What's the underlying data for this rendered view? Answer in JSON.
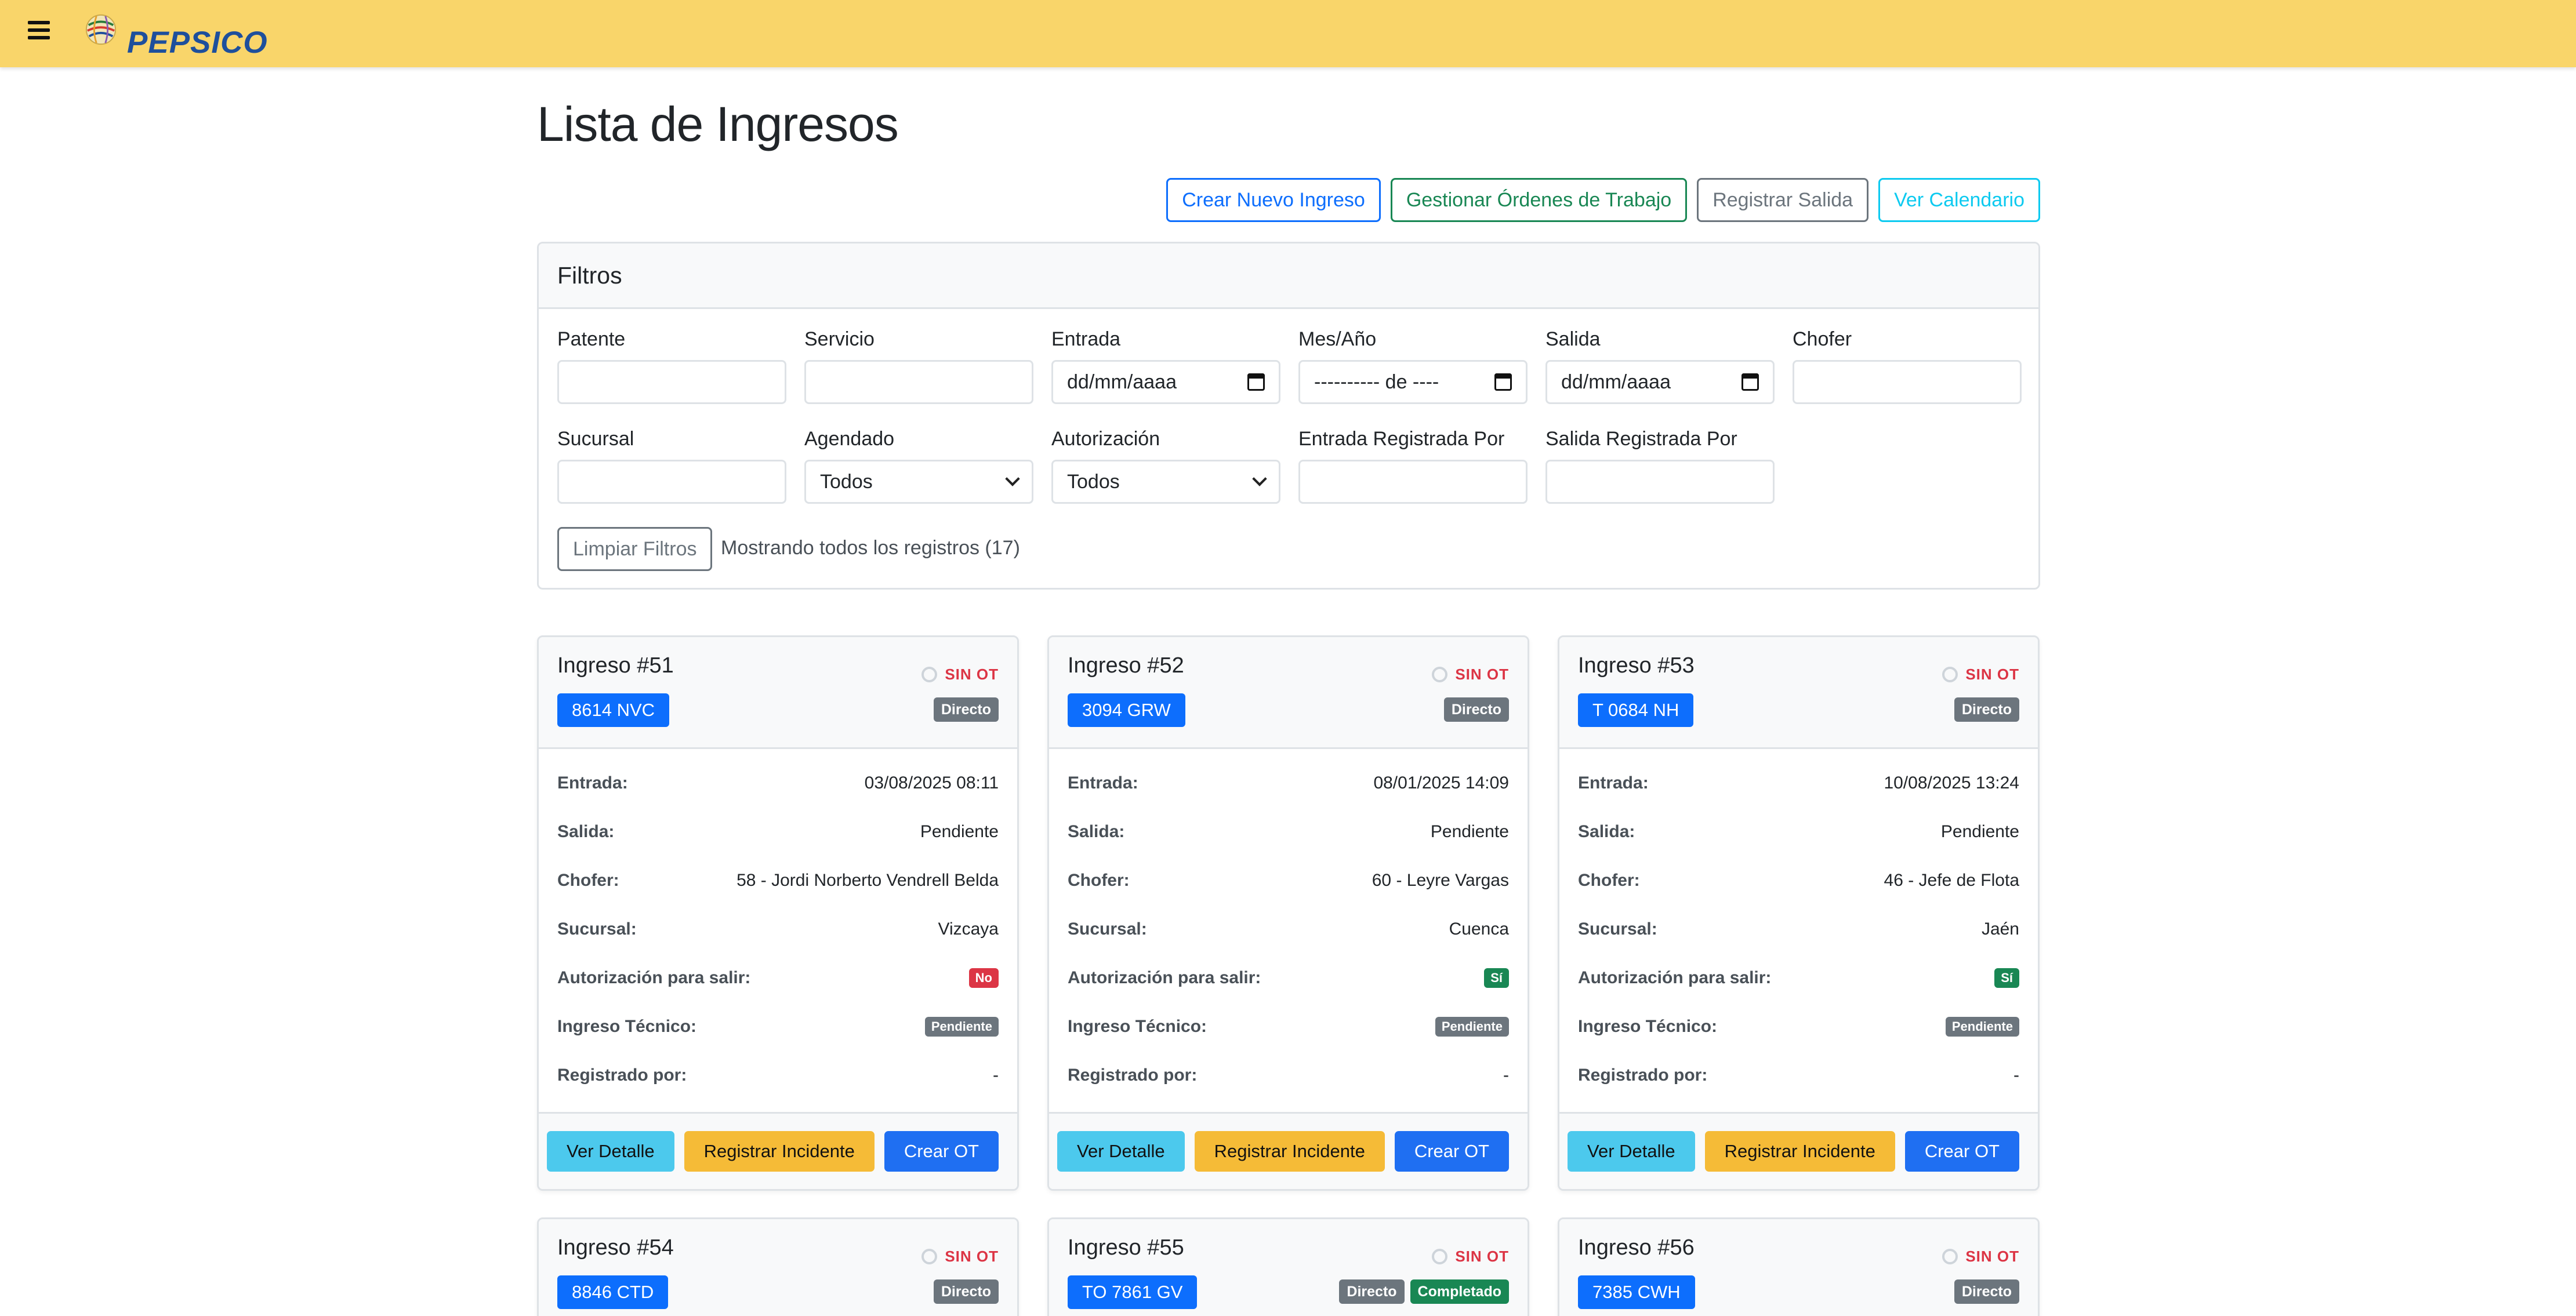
{
  "brand": {
    "name": "PEPSICO"
  },
  "page": {
    "title": "Lista de Ingresos"
  },
  "actions": {
    "new": "Crear Nuevo Ingreso",
    "orders": "Gestionar Órdenes de Trabajo",
    "exit": "Registrar Salida",
    "calendar": "Ver Calendario"
  },
  "filters": {
    "title": "Filtros",
    "patente": "Patente",
    "servicio": "Servicio",
    "entrada": "Entrada",
    "entrada_value": "dd/mm/aaaa",
    "mesano": "Mes/Año",
    "mesano_value": "---------- de ----",
    "salida": "Salida",
    "salida_value": "dd/mm/aaaa",
    "chofer": "Chofer",
    "sucursal": "Sucursal",
    "agendado": "Agendado",
    "agendado_value": "Todos",
    "autorizacion": "Autorización",
    "autorizacion_value": "Todos",
    "entrada_por": "Entrada Registrada Por",
    "salida_por": "Salida Registrada Por",
    "clear": "Limpiar Filtros",
    "showing": "Mostrando todos los registros (17)"
  },
  "labels": {
    "entrada": "Entrada:",
    "salida": "Salida:",
    "chofer": "Chofer:",
    "sucursal": "Sucursal:",
    "autorizacion": "Autorización para salir:",
    "tecnico": "Ingreso Técnico:",
    "registrado": "Registrado por:",
    "sin_ot": "SIN OT",
    "ver": "Ver Detalle",
    "incidente": "Registrar Incidente",
    "crear_ot": "Crear OT"
  },
  "cards": [
    {
      "title": "Ingreso #51",
      "plate": "8614 NVC",
      "type": "Directo",
      "entrada": "03/08/2025 08:11",
      "salida": "Pendiente",
      "chofer": "58 - Jordi Norberto Vendrell Belda",
      "sucursal": "Vizcaya",
      "autorizacion": "No",
      "tecnico": "Pendiente",
      "registrado": "-"
    },
    {
      "title": "Ingreso #52",
      "plate": "3094 GRW",
      "type": "Directo",
      "entrada": "08/01/2025 14:09",
      "salida": "Pendiente",
      "chofer": "60 - Leyre Vargas",
      "sucursal": "Cuenca",
      "autorizacion": "Sí",
      "tecnico": "Pendiente",
      "registrado": "-"
    },
    {
      "title": "Ingreso #53",
      "plate": "T 0684 NH",
      "type": "Directo",
      "entrada": "10/08/2025 13:24",
      "salida": "Pendiente",
      "chofer": "46 - Jefe de Flota",
      "sucursal": "Jaén",
      "autorizacion": "Sí",
      "tecnico": "Pendiente",
      "registrado": "-"
    },
    {
      "title": "Ingreso #54",
      "plate": "8846 CTD",
      "type": "Directo"
    },
    {
      "title": "Ingreso #55",
      "plate": "TO 7861 GV",
      "type": "Directo",
      "status": "Completado"
    },
    {
      "title": "Ingreso #56",
      "plate": "7385 CWH",
      "type": "Directo"
    }
  ]
}
